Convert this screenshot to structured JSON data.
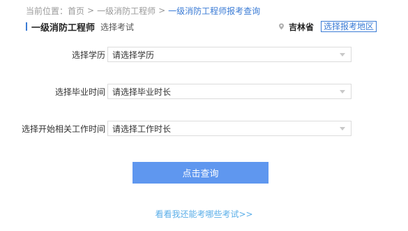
{
  "breadcrumb": {
    "prefix": "当前位置：",
    "items": [
      "首页",
      "一级消防工程师",
      "一级消防工程师报考查询"
    ],
    "separator": ">"
  },
  "exam_bar": {
    "exam_name": "一级消防工程师",
    "choose_exam_label": "选择考试",
    "region_name": "吉林省",
    "region_button_label": "选择报考地区"
  },
  "form": {
    "rows": [
      {
        "label": "选择学历",
        "value": "请选择学历"
      },
      {
        "label": "选择毕业时间",
        "value": "请选择毕业时长"
      },
      {
        "label": "选择开始相关工作时间",
        "value": "请选择工作时长"
      }
    ]
  },
  "actions": {
    "query_label": "点击查询",
    "see_exams_link": "看看我还能考哪些考试>>"
  },
  "colors": {
    "accent": "#3a7bd5",
    "button": "#5f97ef",
    "link": "#5aaee8"
  }
}
